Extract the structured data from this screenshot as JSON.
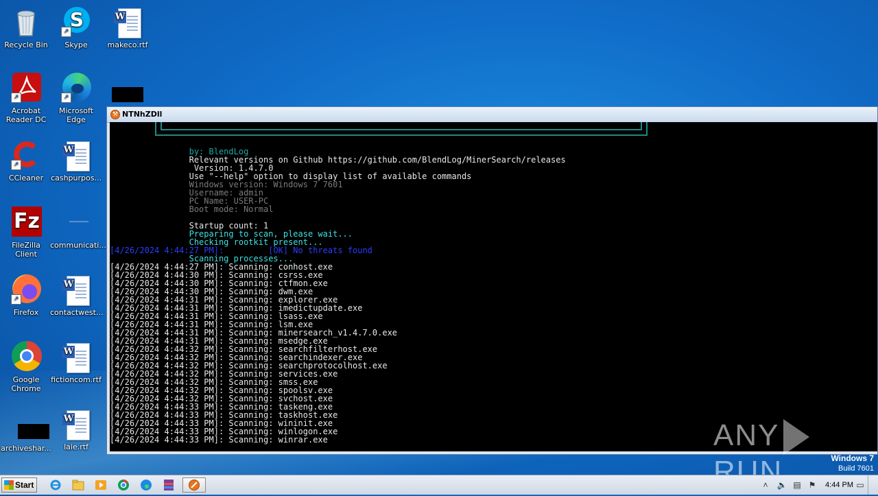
{
  "desktop": {
    "icons": [
      {
        "label": "Recycle Bin",
        "icon": "recycle-bin-icon"
      },
      {
        "label": "Skype",
        "icon": "skype-icon"
      },
      {
        "label": "makeco.rtf",
        "icon": "word-document-icon"
      },
      {
        "label": "Acrobat Reader DC",
        "icon": "acrobat-icon"
      },
      {
        "label": "Microsoft Edge",
        "icon": "edge-icon"
      },
      {
        "label": "CCleaner",
        "icon": "ccleaner-icon"
      },
      {
        "label": "cashpurpos...",
        "icon": "word-document-icon"
      },
      {
        "label": "FileZilla Client",
        "icon": "filezilla-icon"
      },
      {
        "label": "communicati...",
        "icon": "document-icon"
      },
      {
        "label": "Firefox",
        "icon": "firefox-icon"
      },
      {
        "label": "contactwest...",
        "icon": "word-document-icon"
      },
      {
        "label": "Google Chrome",
        "icon": "chrome-icon"
      },
      {
        "label": "fictioncom.rtf",
        "icon": "word-document-icon"
      },
      {
        "label": "archiveshar...",
        "icon": "redacted-icon"
      },
      {
        "label": "laie.rtf",
        "icon": "word-document-icon"
      }
    ]
  },
  "window": {
    "title": "NTNhZDll",
    "console_lines": [
      {
        "text": "                by: BlendLog",
        "color": "teal"
      },
      {
        "text": "                Relevant versions on Github https://github.com/BlendLog/MinerSearch/releases",
        "color": "white"
      },
      {
        "text": "                 Version: 1.4.7.0",
        "color": "white"
      },
      {
        "text": "                Use \"--help\" option to display list of available commands",
        "color": "white"
      },
      {
        "text": "                Windows version: Windows 7 7601",
        "color": "gray"
      },
      {
        "text": "                Username: admin",
        "color": "gray"
      },
      {
        "text": "                PC Name: USER-PC",
        "color": "gray"
      },
      {
        "text": "                Boot mode: Normal",
        "color": "gray"
      },
      {
        "text": "",
        "color": "gray"
      },
      {
        "text": "                Startup count: 1",
        "color": "white"
      },
      {
        "text": "                Preparing to scan, please wait...",
        "color": "cyan"
      },
      {
        "text": "                Checking rootkit present...",
        "color": "cyan"
      },
      {
        "text": "[4/26/2024 4:44:27 PM]:         [OK] No threats found",
        "color": "blue"
      },
      {
        "text": "                Scanning processes...",
        "color": "cyan"
      },
      {
        "text": "[4/26/2024 4:44:27 PM]: Scanning: conhost.exe",
        "color": "white"
      },
      {
        "text": "[4/26/2024 4:44:30 PM]: Scanning: csrss.exe",
        "color": "white"
      },
      {
        "text": "[4/26/2024 4:44:30 PM]: Scanning: ctfmon.exe",
        "color": "white"
      },
      {
        "text": "[4/26/2024 4:44:30 PM]: Scanning: dwm.exe",
        "color": "white"
      },
      {
        "text": "[4/26/2024 4:44:31 PM]: Scanning: explorer.exe",
        "color": "white"
      },
      {
        "text": "[4/26/2024 4:44:31 PM]: Scanning: imedictupdate.exe",
        "color": "white"
      },
      {
        "text": "[4/26/2024 4:44:31 PM]: Scanning: lsass.exe",
        "color": "white"
      },
      {
        "text": "[4/26/2024 4:44:31 PM]: Scanning: lsm.exe",
        "color": "white"
      },
      {
        "text": "[4/26/2024 4:44:31 PM]: Scanning: minersearch_v1.4.7.0.exe",
        "color": "white"
      },
      {
        "text": "[4/26/2024 4:44:31 PM]: Scanning: msedge.exe",
        "color": "white"
      },
      {
        "text": "[4/26/2024 4:44:32 PM]: Scanning: searchfilterhost.exe",
        "color": "white"
      },
      {
        "text": "[4/26/2024 4:44:32 PM]: Scanning: searchindexer.exe",
        "color": "white"
      },
      {
        "text": "[4/26/2024 4:44:32 PM]: Scanning: searchprotocolhost.exe",
        "color": "white"
      },
      {
        "text": "[4/26/2024 4:44:32 PM]: Scanning: services.exe",
        "color": "white"
      },
      {
        "text": "[4/26/2024 4:44:32 PM]: Scanning: smss.exe",
        "color": "white"
      },
      {
        "text": "[4/26/2024 4:44:32 PM]: Scanning: spoolsv.exe",
        "color": "white"
      },
      {
        "text": "[4/26/2024 4:44:32 PM]: Scanning: svchost.exe",
        "color": "white"
      },
      {
        "text": "[4/26/2024 4:44:33 PM]: Scanning: taskeng.exe",
        "color": "white"
      },
      {
        "text": "[4/26/2024 4:44:33 PM]: Scanning: taskhost.exe",
        "color": "white"
      },
      {
        "text": "[4/26/2024 4:44:33 PM]: Scanning: wininit.exe",
        "color": "white"
      },
      {
        "text": "[4/26/2024 4:44:33 PM]: Scanning: winlogon.exe",
        "color": "white"
      },
      {
        "text": "[4/26/2024 4:44:33 PM]: Scanning: winrar.exe",
        "color": "white"
      }
    ]
  },
  "watermark": {
    "left": "ANY",
    "right": "RUN"
  },
  "os_info": {
    "name": "Windows 7",
    "build": "Build 7601"
  },
  "taskbar": {
    "start_label": "Start",
    "pinned": [
      "internet-explorer-icon",
      "explorer-folder-icon",
      "media-player-icon",
      "chrome-icon",
      "edge-icon",
      "winrar-icon",
      "minersearch-icon"
    ],
    "clock": "4:44 PM"
  }
}
